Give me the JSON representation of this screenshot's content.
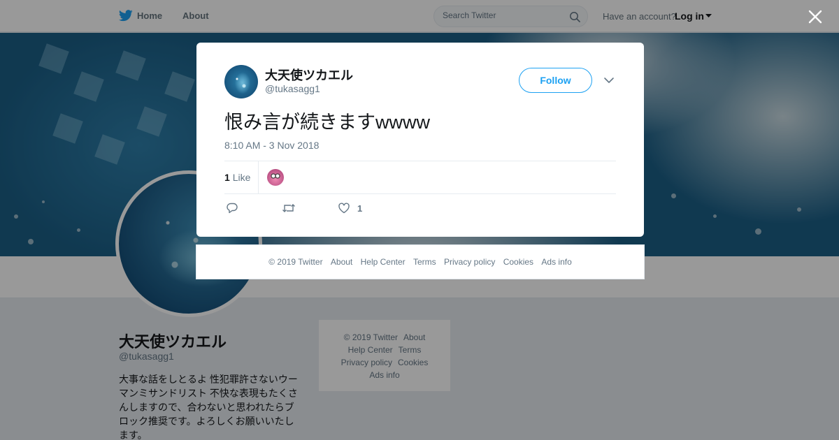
{
  "topbar": {
    "home_label": "Home",
    "about_label": "About",
    "search_placeholder": "Search Twitter",
    "account_prompt": "Have an account?",
    "login_label": "Log in"
  },
  "profile": {
    "name": "大天使ツカエル",
    "handle": "@tukasagg1",
    "bio": "大事な話をしとるよ 性犯罪許さないウーマンミサンドリスト 不快な表現もたくさんしますので、合わないと思われたらブロック推奨です。よろしくお願いいたします。"
  },
  "side_footer": {
    "copyright": "© 2019 Twitter",
    "about": "About",
    "help_center": "Help Center",
    "terms": "Terms",
    "privacy": "Privacy policy",
    "cookies": "Cookies",
    "ads_info": "Ads info"
  },
  "tweet": {
    "author_name": "大天使ツカエル",
    "author_handle": "@tukasagg1",
    "follow_label": "Follow",
    "text": "恨み言が続きますwwww",
    "timestamp": "8:10 AM - 3 Nov 2018",
    "like_count": "1",
    "like_label": "Like",
    "action_like_count": "1"
  },
  "modal_footer": {
    "copyright": "© 2019 Twitter",
    "about": "About",
    "help_center": "Help Center",
    "terms": "Terms",
    "privacy": "Privacy policy",
    "cookies": "Cookies",
    "ads_info": "Ads info"
  },
  "icons": {
    "brand": "twitter-bird-icon",
    "search": "search-icon",
    "close": "close-icon",
    "caret": "chevron-down-icon",
    "reply": "reply-icon",
    "retweet": "retweet-icon",
    "like": "heart-icon"
  },
  "colors": {
    "accent": "#1da1f2",
    "text_secondary": "#657786",
    "overlay": "rgba(0,0,0,0.4)"
  }
}
